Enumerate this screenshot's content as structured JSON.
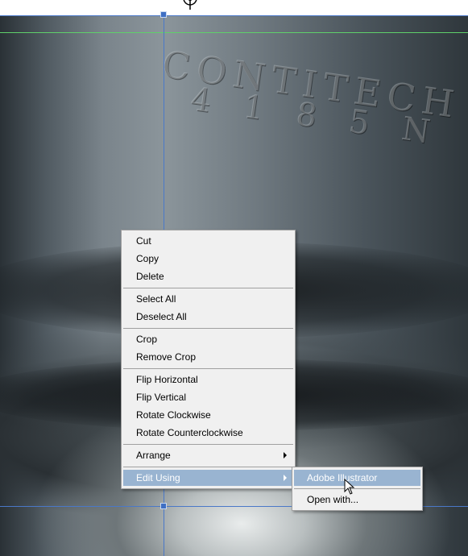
{
  "photo": {
    "engraving_line1": "CONTITECH",
    "engraving_line2": "4 1 8 5  N"
  },
  "context_menu": {
    "items": [
      {
        "label": "Cut"
      },
      {
        "label": "Copy"
      },
      {
        "label": "Delete"
      },
      {
        "label": "Select All"
      },
      {
        "label": "Deselect All"
      },
      {
        "label": "Crop"
      },
      {
        "label": "Remove Crop"
      },
      {
        "label": "Flip Horizontal"
      },
      {
        "label": "Flip Vertical"
      },
      {
        "label": "Rotate Clockwise"
      },
      {
        "label": "Rotate Counterclockwise"
      },
      {
        "label": "Arrange"
      },
      {
        "label": "Edit Using"
      }
    ]
  },
  "submenu": {
    "items": [
      {
        "label": "Adobe Illustrator"
      },
      {
        "label": "Open with..."
      }
    ]
  },
  "colors": {
    "menu_bg": "#f0f0f0",
    "highlight": "#99b4d1",
    "selection_line": "#4a78c8",
    "guide_line": "#5fd06a"
  }
}
